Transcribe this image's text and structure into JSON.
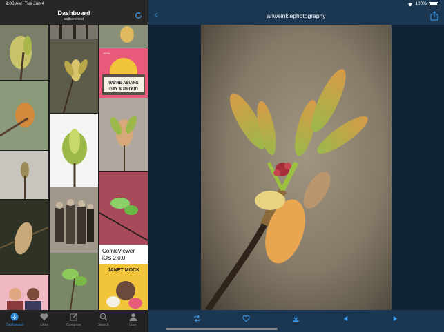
{
  "status_bar": {
    "time": "9:08 AM",
    "date": "Tue Jun 4",
    "battery": "100%"
  },
  "dashboard": {
    "title": "Dashboard",
    "subtitle": "cathandtest",
    "refresh_icon": "refresh-icon",
    "text_post": "ComicViewer iOS 2.0.0",
    "poster_1": {
      "line1": "WE'RE ASIANS",
      "line2": "GAY & PROUD",
      "caption": "1970s"
    },
    "poster_2": {
      "name": "JANET MOCK"
    }
  },
  "tabbar": {
    "items": [
      {
        "label": "Dashboard",
        "icon": "dashboard-icon",
        "active": true
      },
      {
        "label": "Likes",
        "icon": "heart-icon",
        "active": false
      },
      {
        "label": "Compose",
        "icon": "compose-icon",
        "active": false
      },
      {
        "label": "Search",
        "icon": "search-icon",
        "active": false
      },
      {
        "label": "User",
        "icon": "user-icon",
        "active": false
      }
    ]
  },
  "viewer": {
    "back_label": "<",
    "title": "ariweinklephotography",
    "share_icon": "share-icon",
    "toolbar_icons": [
      "reblog-icon",
      "heart-icon",
      "download-icon",
      "previous-icon",
      "next-icon"
    ]
  },
  "colors": {
    "accent": "#3c9bf0",
    "viewer_bg": "#102336",
    "viewer_bar": "#1a3650",
    "sidebar_bg": "#1d1d1d"
  }
}
